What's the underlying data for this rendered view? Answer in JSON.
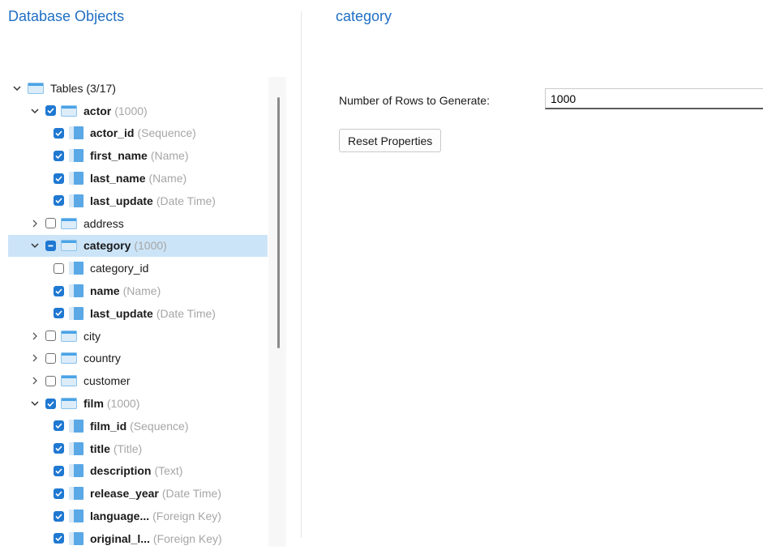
{
  "left_panel": {
    "title": "Database Objects"
  },
  "right_panel": {
    "title": "category",
    "rows_label": "Number of Rows to Generate:",
    "rows_value": "1000",
    "reset_label": "Reset Properties"
  },
  "tree": [
    {
      "level": 0,
      "expand": "open",
      "check": "none",
      "icon": "table-icon",
      "name": "Tables (3/17)",
      "hint": "",
      "bold": false
    },
    {
      "level": 1,
      "expand": "open",
      "check": "checked",
      "icon": "table-icon",
      "name": "actor",
      "hint": "(1000)",
      "bold": true
    },
    {
      "level": 2,
      "expand": "none",
      "check": "checked",
      "icon": "column-icon",
      "name": "actor_id",
      "hint": "(Sequence)",
      "bold": true
    },
    {
      "level": 2,
      "expand": "none",
      "check": "checked",
      "icon": "column-icon",
      "name": "first_name",
      "hint": "(Name)",
      "bold": true
    },
    {
      "level": 2,
      "expand": "none",
      "check": "checked",
      "icon": "column-icon",
      "name": "last_name",
      "hint": "(Name)",
      "bold": true
    },
    {
      "level": 2,
      "expand": "none",
      "check": "checked",
      "icon": "column-icon",
      "name": "last_update",
      "hint": "(Date Time)",
      "bold": true
    },
    {
      "level": 1,
      "expand": "closed",
      "check": "unchecked",
      "icon": "table-icon",
      "name": "address",
      "hint": "",
      "bold": false
    },
    {
      "level": 1,
      "expand": "open",
      "check": "partial",
      "icon": "table-icon",
      "name": "category",
      "hint": "(1000)",
      "bold": true,
      "selected": true
    },
    {
      "level": 2,
      "expand": "none",
      "check": "unchecked",
      "icon": "column-icon",
      "name": "category_id",
      "hint": "",
      "bold": false
    },
    {
      "level": 2,
      "expand": "none",
      "check": "checked",
      "icon": "column-icon",
      "name": "name",
      "hint": "(Name)",
      "bold": true
    },
    {
      "level": 2,
      "expand": "none",
      "check": "checked",
      "icon": "column-icon",
      "name": "last_update",
      "hint": "(Date Time)",
      "bold": true
    },
    {
      "level": 1,
      "expand": "closed",
      "check": "unchecked",
      "icon": "table-icon",
      "name": "city",
      "hint": "",
      "bold": false
    },
    {
      "level": 1,
      "expand": "closed",
      "check": "unchecked",
      "icon": "table-icon",
      "name": "country",
      "hint": "",
      "bold": false
    },
    {
      "level": 1,
      "expand": "closed",
      "check": "unchecked",
      "icon": "table-icon",
      "name": "customer",
      "hint": "",
      "bold": false
    },
    {
      "level": 1,
      "expand": "open",
      "check": "checked",
      "icon": "table-icon",
      "name": "film",
      "hint": "(1000)",
      "bold": true
    },
    {
      "level": 2,
      "expand": "none",
      "check": "checked",
      "icon": "column-icon",
      "name": "film_id",
      "hint": "(Sequence)",
      "bold": true
    },
    {
      "level": 2,
      "expand": "none",
      "check": "checked",
      "icon": "column-icon",
      "name": "title",
      "hint": "(Title)",
      "bold": true
    },
    {
      "level": 2,
      "expand": "none",
      "check": "checked",
      "icon": "column-icon",
      "name": "description",
      "hint": "(Text)",
      "bold": true
    },
    {
      "level": 2,
      "expand": "none",
      "check": "checked",
      "icon": "column-icon",
      "name": "release_year",
      "hint": "(Date Time)",
      "bold": true
    },
    {
      "level": 2,
      "expand": "none",
      "check": "checked",
      "icon": "column-icon",
      "name": "language...",
      "hint": "(Foreign Key)",
      "bold": true
    },
    {
      "level": 2,
      "expand": "none",
      "check": "checked",
      "icon": "column-icon",
      "name": "original_l...",
      "hint": "(Foreign Key)",
      "bold": true
    }
  ],
  "colors": {
    "accent": "#1f6fc4",
    "selection": "#cce4f7",
    "checkbox": "#1f78d1"
  }
}
